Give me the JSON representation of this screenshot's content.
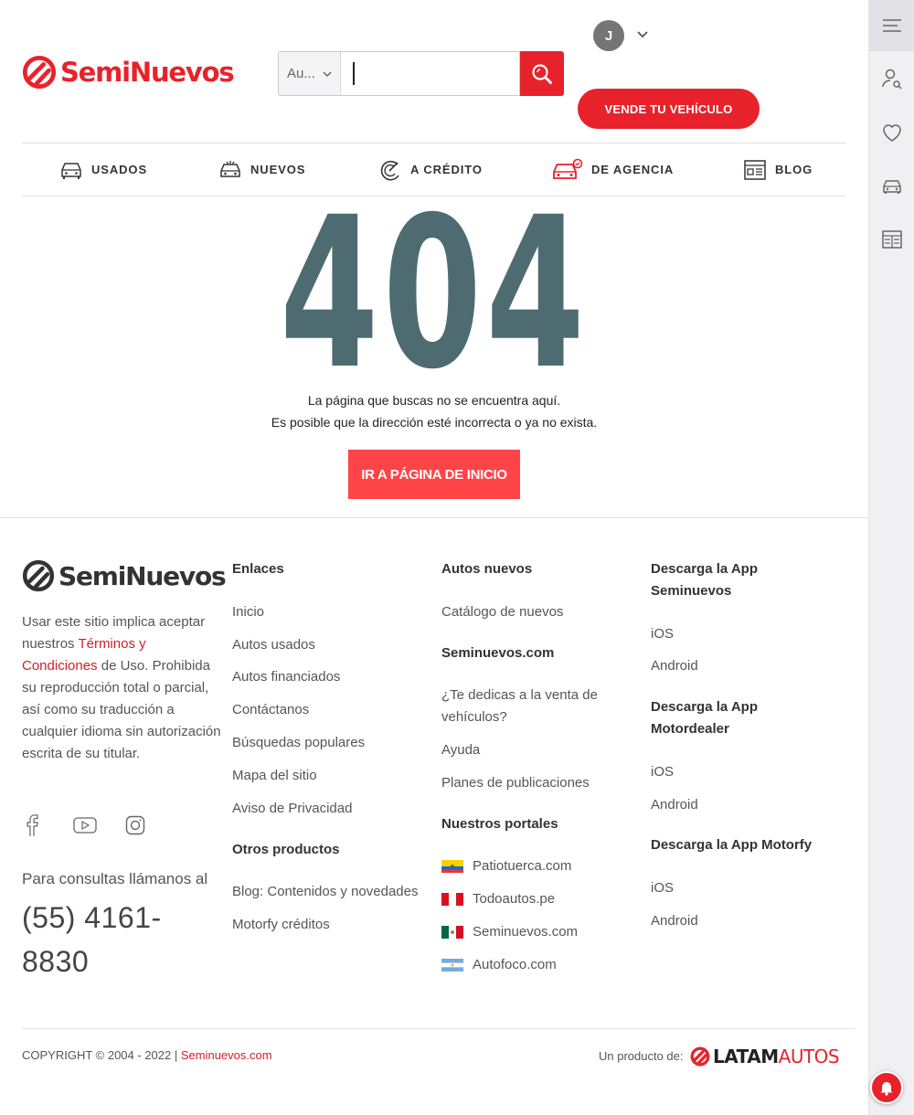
{
  "header": {
    "logo_text": "SemiNuevos",
    "search": {
      "category": "Au...",
      "value": "",
      "placeholder": ""
    },
    "avatar_initial": "J",
    "sell_button": "VENDE TU VEHÍCULO"
  },
  "nav": [
    {
      "label": "USADOS",
      "icon": "car-front-icon"
    },
    {
      "label": "NUEVOS",
      "icon": "new-car-icon"
    },
    {
      "label": "A CRÉDITO",
      "icon": "credit-icon"
    },
    {
      "label": "DE AGENCIA",
      "icon": "agency-car-icon"
    },
    {
      "label": "BLOG",
      "icon": "blog-icon"
    }
  ],
  "error": {
    "code": "404",
    "line1": "La página que buscas no se encuentra aquí.",
    "line2": "Es posible que la dirección esté incorrecta o ya no exista.",
    "button": "IR A PÁGINA DE INICIO"
  },
  "footer": {
    "logo_text": "SemiNuevos",
    "legal_prefix": "Usar este sitio implica aceptar nuestros ",
    "legal_link": "Términos y Condiciones",
    "legal_suffix": " de Uso. Prohibida su reproducción total o parcial, así como su traducción a cualquier idioma sin autorización escrita de su titular.",
    "phone_label": "Para consultas llámanos al",
    "phone": "(55) 4161-8830",
    "enlaces": {
      "title": "Enlaces",
      "items": [
        "Inicio",
        "Autos usados",
        "Autos financiados",
        "Contáctanos",
        "Búsquedas populares",
        "Mapa del sitio",
        "Aviso de Privacidad"
      ]
    },
    "otros": {
      "title": "Otros productos",
      "items": [
        "Blog: Contenidos y novedades",
        "Motorfy créditos"
      ]
    },
    "nuevos": {
      "title": "Autos nuevos",
      "items": [
        "Catálogo de nuevos"
      ]
    },
    "seminuevos": {
      "title": "Seminuevos.com",
      "items": [
        "¿Te dedicas a la venta de vehículos?",
        "Ayuda",
        "Planes de publicaciones"
      ]
    },
    "portales": {
      "title": "Nuestros portales",
      "items": [
        "Patiotuerca.com",
        "Todoautos.pe",
        "Seminuevos.com",
        "Autofoco.com"
      ]
    },
    "app1": {
      "title": "Descarga la App Seminuevos",
      "items": [
        "iOS",
        "Android"
      ]
    },
    "app2": {
      "title": "Descarga la App Motordealer",
      "items": [
        "iOS",
        "Android"
      ]
    },
    "app3": {
      "title": "Descarga la App Motorfy",
      "items": [
        "iOS",
        "Android"
      ]
    },
    "copyright_prefix": "COPYRIGHT © 2004 - 2022 | ",
    "copyright_link": "Seminuevos.com",
    "product_by": "Un producto de:",
    "latam_a": "LATAM",
    "latam_b": "AUTOS"
  },
  "colors": {
    "brand_red": "#e8222b",
    "number_404": "#4d6b70",
    "button_red": "#ff4447"
  }
}
